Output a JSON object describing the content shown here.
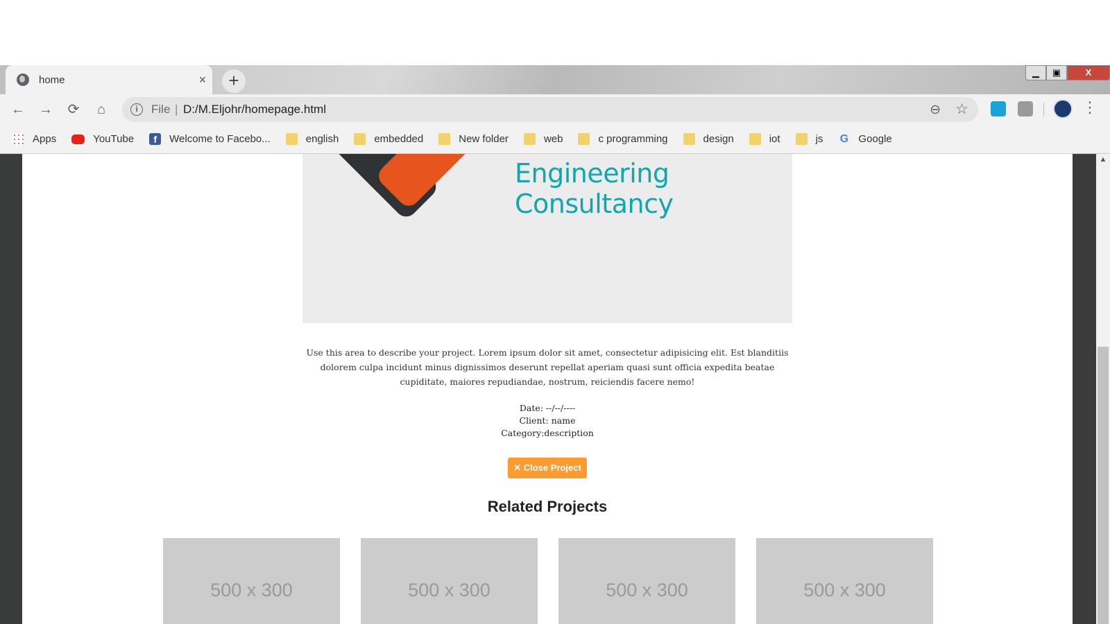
{
  "browser": {
    "tab_title": "home",
    "tab_close_glyph": "×",
    "new_tab_glyph": "+",
    "window_controls": {
      "minimize": "▁",
      "maximize": "▣",
      "close": "X"
    },
    "address": {
      "scheme": "File",
      "separator": "|",
      "url": "D:/M.Eljohr/homepage.html"
    },
    "nav_icons": {
      "back": "←",
      "forward": "→",
      "reload": "⟳",
      "home": "⌂",
      "zoom": "⊖",
      "star": "☆",
      "menu": "⋮",
      "info": "i"
    },
    "bookmarks": [
      {
        "label": "Apps",
        "icon": "apps-icon"
      },
      {
        "label": "YouTube",
        "icon": "youtube-icon"
      },
      {
        "label": "Welcome to Facebo...",
        "icon": "facebook-icon"
      },
      {
        "label": "english",
        "icon": "folder-icon"
      },
      {
        "label": "embedded",
        "icon": "folder-icon"
      },
      {
        "label": "New folder",
        "icon": "folder-icon"
      },
      {
        "label": "web",
        "icon": "folder-icon"
      },
      {
        "label": "c programming",
        "icon": "folder-icon"
      },
      {
        "label": "design",
        "icon": "folder-icon"
      },
      {
        "label": "iot",
        "icon": "folder-icon"
      },
      {
        "label": "js",
        "icon": "folder-icon"
      },
      {
        "label": "Google",
        "icon": "google-icon"
      }
    ]
  },
  "page": {
    "logo_text": "Engineering Consultancy",
    "description": "Use this area to describe your project. Lorem ipsum dolor sit amet, consectetur adipisicing elit. Est blanditiis dolorem culpa incidunt minus dignissimos deserunt repellat aperiam quasi sunt officia expedita beatae cupiditate, maiores repudiandae, nostrum, reiciendis facere nemo!",
    "meta": {
      "date": "Date: --/--/----",
      "client": "Client: name",
      "category": "Category:description"
    },
    "close_button": "✕ Close Project",
    "related_heading": "Related Projects",
    "thumbnails": [
      "500 x 300",
      "500 x 300",
      "500 x 300",
      "500 x 300"
    ]
  },
  "colors": {
    "accent_orange": "#fe9b2f",
    "logo_teal": "#11a7ac",
    "logo_orange": "#e8541d",
    "placeholder_gray": "#cccccc"
  }
}
